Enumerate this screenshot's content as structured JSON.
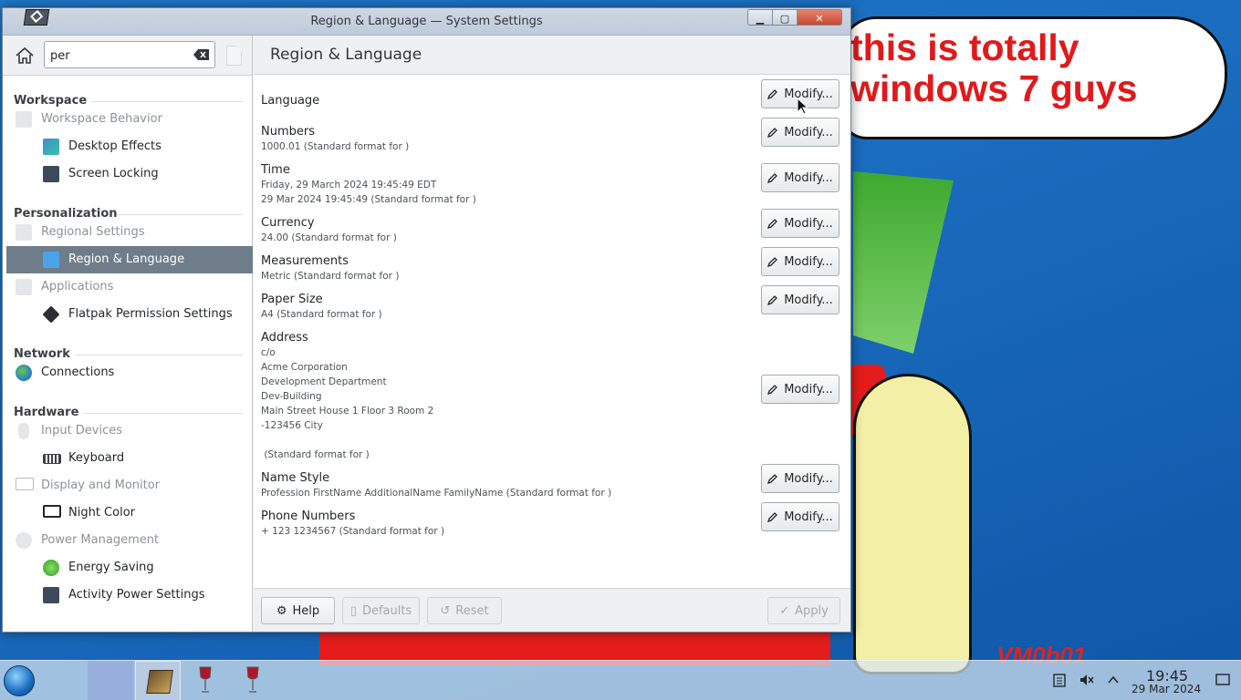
{
  "window": {
    "title": "Region & Language — System Settings"
  },
  "wallpaper": {
    "meme_text": "this is totally windows 7 guys",
    "watermark": "VM0b01"
  },
  "sidebar": {
    "search_value": "per",
    "sections": {
      "workspace": "Workspace",
      "personalization": "Personalization",
      "network": "Network",
      "hardware": "Hardware"
    },
    "items": {
      "workspace_behavior": "Workspace Behavior",
      "desktop_effects": "Desktop Effects",
      "screen_locking": "Screen Locking",
      "regional_settings": "Regional Settings",
      "region_language": "Region & Language",
      "applications": "Applications",
      "flatpak": "Flatpak Permission Settings",
      "connections": "Connections",
      "input_devices": "Input Devices",
      "keyboard": "Keyboard",
      "display_monitor": "Display and Monitor",
      "night_color": "Night Color",
      "power_management": "Power Management",
      "energy_saving": "Energy Saving",
      "activity_power": "Activity Power Settings"
    }
  },
  "content": {
    "page_title": "Region & Language",
    "modify_label": "Modify...",
    "rows": {
      "language": {
        "title": "Language"
      },
      "numbers": {
        "title": "Numbers",
        "sub": "1000.01 (Standard format for )"
      },
      "time": {
        "title": "Time",
        "sub1": "Friday, 29 March 2024 19:45:49 EDT",
        "sub2": "29 Mar 2024 19:45:49 (Standard format for )"
      },
      "currency": {
        "title": "Currency",
        "sub": "24.00 (Standard format for )"
      },
      "measurements": {
        "title": "Measurements",
        "sub": "Metric (Standard format for )"
      },
      "paper_size": {
        "title": "Paper Size",
        "sub": "A4 (Standard format for )"
      },
      "address": {
        "title": "Address",
        "lines": [
          "c/o",
          "Acme Corporation",
          "Development Department",
          "Dev-Building",
          "Main Street House 1 Floor 3 Room 2",
          "-123456 City"
        ],
        "standard": " (Standard format for )"
      },
      "name_style": {
        "title": "Name Style",
        "sub": "Profession FirstName AdditionalName FamilyName (Standard format for )"
      },
      "phone": {
        "title": "Phone Numbers",
        "sub": "+ 123 1234567 (Standard format for )"
      }
    }
  },
  "footer": {
    "help": "Help",
    "defaults": "Defaults",
    "reset": "Reset",
    "apply": "Apply"
  },
  "taskbar": {
    "time": "19:45",
    "date": "29 Mar 2024"
  },
  "colors": {
    "selection": "#6f7d8b",
    "meme_red": "#e0191b",
    "desktop_blue": "#1a6bbd"
  }
}
